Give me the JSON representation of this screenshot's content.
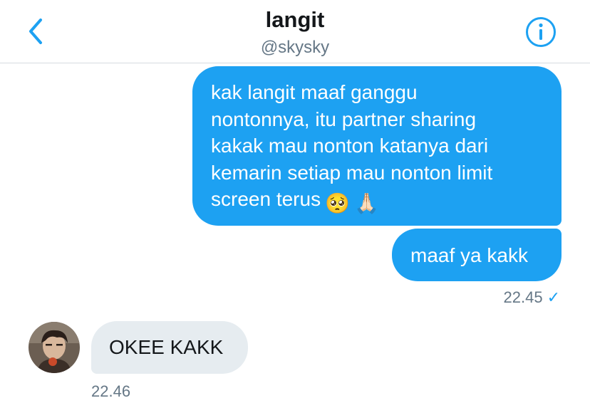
{
  "header": {
    "title": "langit",
    "handle": "@skysky",
    "back_icon": "chevron-left-icon",
    "info_icon": "info-circle-icon",
    "accent_color": "#1da1f2"
  },
  "messages": [
    {
      "direction": "outgoing",
      "lines": [
        "kak langit maaf ganggu",
        "nontonnya, itu partner sharing",
        "kakak mau nonton katanya dari",
        "kemarin setiap mau nonton limit",
        "screen terus"
      ],
      "emojis": [
        "🥺",
        "🙏🏻"
      ]
    },
    {
      "direction": "outgoing",
      "text": "maaf ya kakk",
      "time": "22.45",
      "status": "✓"
    },
    {
      "direction": "incoming",
      "text": "OKEE KAKK",
      "time": "22.46"
    }
  ],
  "colors": {
    "outgoing_bubble": "#1da1f2",
    "incoming_bubble": "#e6ecf0",
    "meta_text": "#657786"
  }
}
